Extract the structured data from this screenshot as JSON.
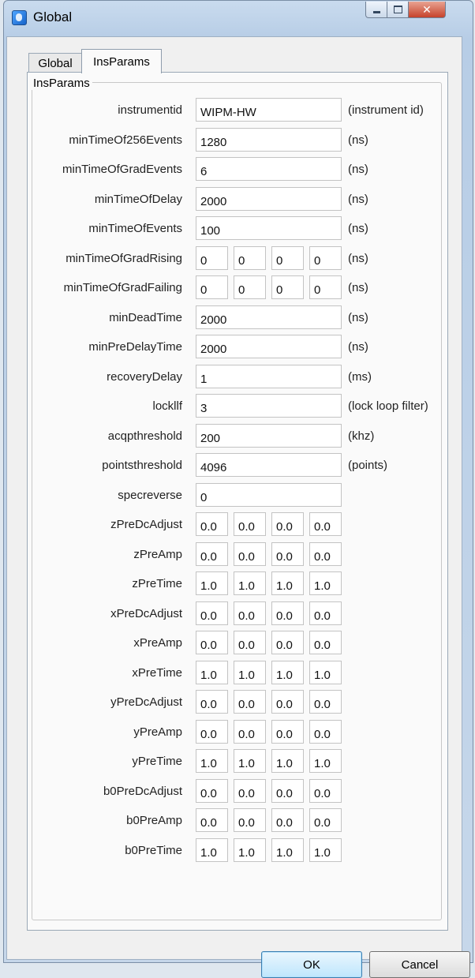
{
  "window": {
    "title": "Global",
    "controls": {
      "minimize": "—",
      "maximize": "□",
      "close": "✕"
    }
  },
  "tabs": [
    {
      "label": "Global",
      "active": false
    },
    {
      "label": "InsParams",
      "active": true
    }
  ],
  "group": {
    "title": "InsParams"
  },
  "params": [
    {
      "label": "instrumentid",
      "values": [
        "WIPM-HW"
      ],
      "unit": "(instrument id)"
    },
    {
      "label": "minTimeOf256Events",
      "values": [
        "1280"
      ],
      "unit": "(ns)"
    },
    {
      "label": "minTimeOfGradEvents",
      "values": [
        "6"
      ],
      "unit": "(ns)"
    },
    {
      "label": "minTimeOfDelay",
      "values": [
        "2000"
      ],
      "unit": "(ns)"
    },
    {
      "label": "minTimeOfEvents",
      "values": [
        "100"
      ],
      "unit": "(ns)"
    },
    {
      "label": "minTimeOfGradRising",
      "values": [
        "0",
        "0",
        "0",
        "0"
      ],
      "unit": "(ns)"
    },
    {
      "label": "minTimeOfGradFailing",
      "values": [
        "0",
        "0",
        "0",
        "0"
      ],
      "unit": "(ns)"
    },
    {
      "label": "minDeadTime",
      "values": [
        "2000"
      ],
      "unit": "(ns)"
    },
    {
      "label": "minPreDelayTime",
      "values": [
        "2000"
      ],
      "unit": "(ns)"
    },
    {
      "label": "recoveryDelay",
      "values": [
        "1"
      ],
      "unit": "(ms)"
    },
    {
      "label": "lockllf",
      "values": [
        "3"
      ],
      "unit": "(lock loop filter)"
    },
    {
      "label": "acqpthreshold",
      "values": [
        "200"
      ],
      "unit": "(khz)"
    },
    {
      "label": "pointsthreshold",
      "values": [
        "4096"
      ],
      "unit": "(points)"
    },
    {
      "label": "specreverse",
      "values": [
        "0"
      ],
      "unit": ""
    },
    {
      "label": "zPreDcAdjust",
      "values": [
        "0.0",
        "0.0",
        "0.0",
        "0.0"
      ],
      "unit": ""
    },
    {
      "label": "zPreAmp",
      "values": [
        "0.0",
        "0.0",
        "0.0",
        "0.0"
      ],
      "unit": ""
    },
    {
      "label": "zPreTime",
      "values": [
        "1.0",
        "1.0",
        "1.0",
        "1.0"
      ],
      "unit": ""
    },
    {
      "label": "xPreDcAdjust",
      "values": [
        "0.0",
        "0.0",
        "0.0",
        "0.0"
      ],
      "unit": ""
    },
    {
      "label": "xPreAmp",
      "values": [
        "0.0",
        "0.0",
        "0.0",
        "0.0"
      ],
      "unit": ""
    },
    {
      "label": "xPreTime",
      "values": [
        "1.0",
        "1.0",
        "1.0",
        "1.0"
      ],
      "unit": ""
    },
    {
      "label": "yPreDcAdjust",
      "values": [
        "0.0",
        "0.0",
        "0.0",
        "0.0"
      ],
      "unit": ""
    },
    {
      "label": "yPreAmp",
      "values": [
        "0.0",
        "0.0",
        "0.0",
        "0.0"
      ],
      "unit": ""
    },
    {
      "label": "yPreTime",
      "values": [
        "1.0",
        "1.0",
        "1.0",
        "1.0"
      ],
      "unit": ""
    },
    {
      "label": "b0PreDcAdjust",
      "values": [
        "0.0",
        "0.0",
        "0.0",
        "0.0"
      ],
      "unit": ""
    },
    {
      "label": "b0PreAmp",
      "values": [
        "0.0",
        "0.0",
        "0.0",
        "0.0"
      ],
      "unit": ""
    },
    {
      "label": "b0PreTime",
      "values": [
        "1.0",
        "1.0",
        "1.0",
        "1.0"
      ],
      "unit": ""
    }
  ],
  "buttons": {
    "ok": "OK",
    "cancel": "Cancel"
  }
}
